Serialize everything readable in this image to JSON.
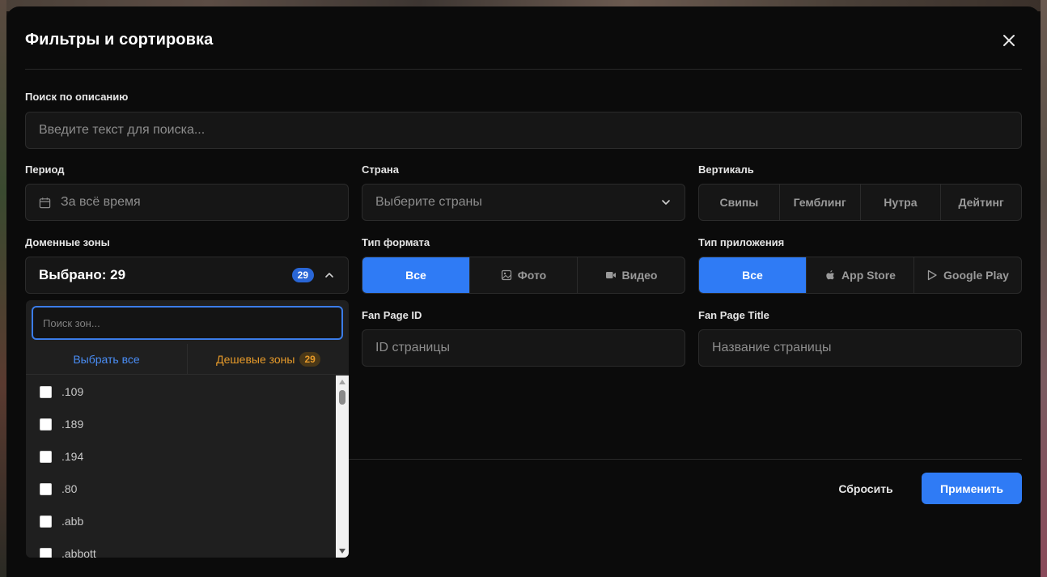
{
  "modal": {
    "title": "Фильтры и сортировка"
  },
  "search": {
    "label": "Поиск по описанию",
    "placeholder": "Введите текст для поиска..."
  },
  "period": {
    "label": "Период",
    "value": "За всё время"
  },
  "country": {
    "label": "Страна",
    "placeholder": "Выберите страны"
  },
  "vertical": {
    "label": "Вертикаль",
    "options": [
      "Свипы",
      "Гемблинг",
      "Нутра",
      "Дейтинг"
    ]
  },
  "domain_zones": {
    "label": "Доменные зоны",
    "selected_text": "Выбрано: 29",
    "count": "29",
    "dropdown": {
      "search_placeholder": "Поиск зон...",
      "select_all": "Выбрать все",
      "cheap_zones": "Дешевые зоны",
      "cheap_count": "29",
      "items": [
        ".109",
        ".189",
        ".194",
        ".80",
        ".abb",
        ".abbott"
      ]
    }
  },
  "format_type": {
    "label": "Тип формата",
    "options": [
      "Все",
      "Фото",
      "Видео"
    ],
    "active": "Все"
  },
  "app_type": {
    "label": "Тип приложения",
    "options": [
      "Все",
      "App Store",
      "Google Play"
    ],
    "active": "Все"
  },
  "fan_page_id": {
    "label": "Fan Page ID",
    "placeholder": "ID страницы"
  },
  "fan_page_title": {
    "label": "Fan Page Title",
    "placeholder": "Название страницы"
  },
  "footer": {
    "reset": "Сбросить",
    "apply": "Применить"
  },
  "colors": {
    "accent": "#2f7bf5",
    "cheap": "#e69a2a",
    "background": "#0b0b0b"
  }
}
